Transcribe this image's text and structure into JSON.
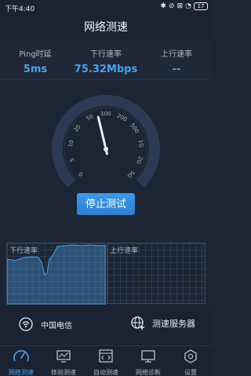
{
  "status_bar": {
    "time": "下午4:40",
    "battery": "17"
  },
  "header": {
    "title": "网络测速"
  },
  "metrics": [
    {
      "label": "Ping时延",
      "value": "5ms"
    },
    {
      "label": "下行速率",
      "value": "75.32Mbps"
    },
    {
      "label": "上行速率",
      "value": "--"
    }
  ],
  "gauge": {
    "ticks": [
      "0",
      "5",
      "10",
      "20",
      "50",
      "100",
      "200",
      "500",
      "1G",
      "2G",
      "5G"
    ],
    "needle_value": 75.32
  },
  "action": {
    "stop_label": "停止测试"
  },
  "graphs": {
    "download_label": "下行速率",
    "upload_label": "上行速率"
  },
  "info": {
    "carrier": "中国电信",
    "server_label": "测速服务器"
  },
  "tabs": [
    {
      "label": "网络测速",
      "icon": "speedometer-icon",
      "active": true
    },
    {
      "label": "体验测速",
      "icon": "monitor-chart-icon",
      "active": false
    },
    {
      "label": "自动测速",
      "icon": "code-window-icon",
      "active": false
    },
    {
      "label": "网络诊断",
      "icon": "desktop-icon",
      "active": false
    },
    {
      "label": "设置",
      "icon": "gear-icon",
      "active": false
    }
  ],
  "colors": {
    "accent": "#4aa3ea",
    "background": "#1d2535",
    "gauge_track": "#2c3a55"
  }
}
